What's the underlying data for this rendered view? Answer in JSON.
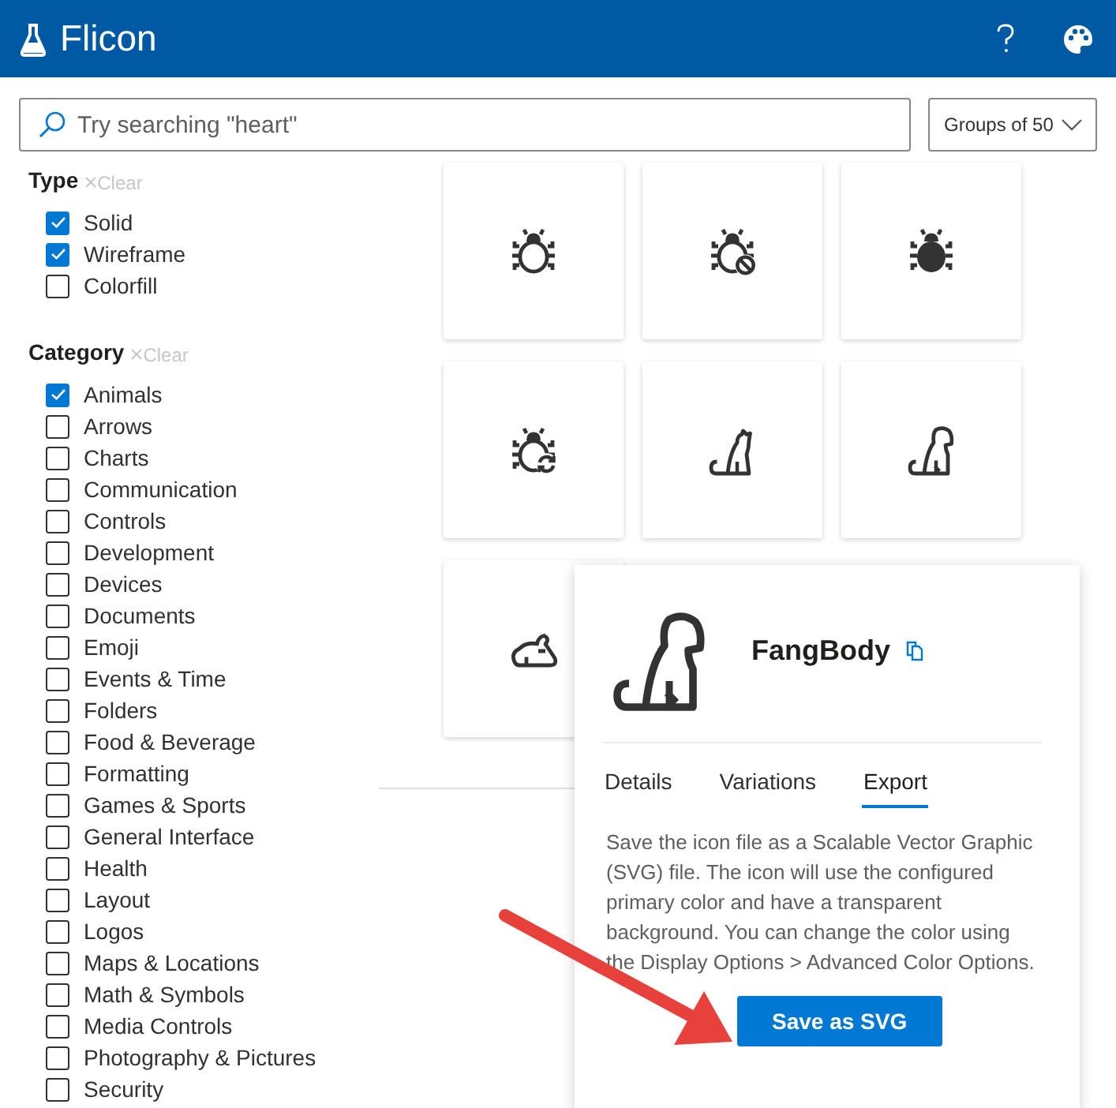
{
  "header": {
    "title": "Flicon"
  },
  "search": {
    "placeholder": "Try searching \"heart\""
  },
  "group_select": {
    "value": "Groups of 50"
  },
  "filters": [
    {
      "heading": "Type",
      "clear": "Clear",
      "options": [
        {
          "label": "Solid",
          "checked": true
        },
        {
          "label": "Wireframe",
          "checked": true
        },
        {
          "label": "Colorfill",
          "checked": false
        }
      ]
    },
    {
      "heading": "Category",
      "clear": "Clear",
      "options": [
        {
          "label": "Animals",
          "checked": true
        },
        {
          "label": "Arrows",
          "checked": false
        },
        {
          "label": "Charts",
          "checked": false
        },
        {
          "label": "Communication",
          "checked": false
        },
        {
          "label": "Controls",
          "checked": false
        },
        {
          "label": "Development",
          "checked": false
        },
        {
          "label": "Devices",
          "checked": false
        },
        {
          "label": "Documents",
          "checked": false
        },
        {
          "label": "Emoji",
          "checked": false
        },
        {
          "label": "Events & Time",
          "checked": false
        },
        {
          "label": "Folders",
          "checked": false
        },
        {
          "label": "Food & Beverage",
          "checked": false
        },
        {
          "label": "Formatting",
          "checked": false
        },
        {
          "label": "Games & Sports",
          "checked": false
        },
        {
          "label": "General Interface",
          "checked": false
        },
        {
          "label": "Health",
          "checked": false
        },
        {
          "label": "Layout",
          "checked": false
        },
        {
          "label": "Logos",
          "checked": false
        },
        {
          "label": "Maps & Locations",
          "checked": false
        },
        {
          "label": "Math & Symbols",
          "checked": false
        },
        {
          "label": "Media Controls",
          "checked": false
        },
        {
          "label": "Photography & Pictures",
          "checked": false
        },
        {
          "label": "Security",
          "checked": false
        }
      ]
    }
  ],
  "icons": [
    {
      "kind": "bug"
    },
    {
      "kind": "bug-blocked"
    },
    {
      "kind": "bug-solid"
    },
    {
      "kind": "bug-refresh"
    },
    {
      "kind": "cat"
    },
    {
      "kind": "dog"
    },
    {
      "kind": "rabbit"
    }
  ],
  "detail": {
    "kind": "dog",
    "name": "FangBody",
    "tabs": [
      {
        "label": "Details",
        "selected": false
      },
      {
        "label": "Variations",
        "selected": false
      },
      {
        "label": "Export",
        "selected": true
      }
    ],
    "description": "Save the icon file as a Scalable Vector Graphic (SVG) file. The icon will use the configured primary color and have a transparent background. You can change the color using the Display Options > Advanced Color Options.",
    "button": "Save as SVG"
  }
}
